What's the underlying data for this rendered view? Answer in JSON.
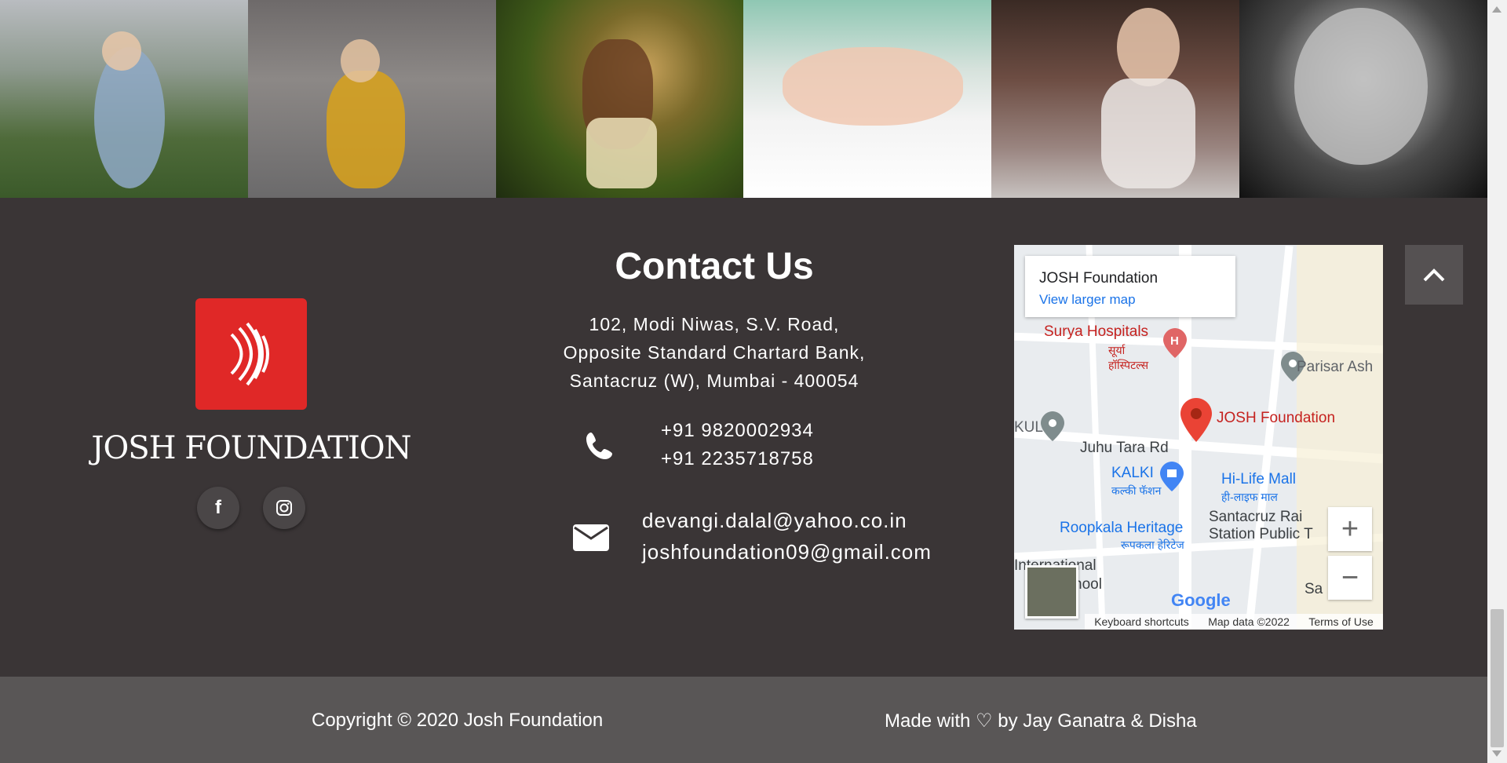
{
  "gallery": {
    "photos": [
      {
        "name": "child-reaching-photo"
      },
      {
        "name": "child-bubbles-photo"
      },
      {
        "name": "child-grass-photo"
      },
      {
        "name": "baby-bed-photo"
      },
      {
        "name": "baby-crib-photo"
      },
      {
        "name": "baby-portrait-photo"
      }
    ]
  },
  "brand": {
    "name": "JOSH FOUNDATION",
    "logo_color": "#e02827",
    "socials": [
      {
        "icon": "facebook-icon",
        "glyph": "f"
      },
      {
        "icon": "instagram-icon",
        "glyph": "◎"
      }
    ]
  },
  "contact": {
    "title": "Contact Us",
    "address_lines": [
      "102, Modi Niwas, S.V. Road,",
      "Opposite Standard Chartard Bank,",
      "Santacruz (W), Mumbai - 400054"
    ],
    "phones": [
      "+91 9820002934",
      "+91 2235718758"
    ],
    "emails": [
      "devangi.dalal@yahoo.co.in",
      "joshfoundation09@gmail.com"
    ],
    "phone_icon": "phone-icon",
    "email_icon": "envelope-icon"
  },
  "map": {
    "place_title": "JOSH Foundation",
    "view_larger": "View larger map",
    "labels": {
      "surya": "Surya Hospitals",
      "surya_hi": "सूर्या हॉस्पिटल्स",
      "parisar": "Parisar Ash",
      "josh": "JOSH Foundation",
      "kul": "KUL",
      "juhu": "Juhu Tara Rd",
      "kalki": "KALKI",
      "kalki_hi": "कल्की फॅशन",
      "hilife": "Hi-Life Mall",
      "hilife_hi": "ही-लाइफ माल",
      "roopkala": "Roopkala Heritage",
      "roopkala_hi": "रूपकला हेरिटेज",
      "santacruz": "Santacruz Rai",
      "station": "Station Public T",
      "international": "International",
      "school": "hool",
      "sa": "Sa"
    },
    "zoom_in": "+",
    "zoom_out": "−",
    "google": "Google",
    "footer": {
      "shortcuts": "Keyboard shortcuts",
      "data": "Map data ©2022",
      "terms": "Terms of Use"
    }
  },
  "back_to_top_icon": "chevron-up-icon",
  "footer": {
    "copyright": "Copyright © 2020 Josh Foundation",
    "made_with": "Made with ♡ by Jay Ganatra & Disha"
  }
}
